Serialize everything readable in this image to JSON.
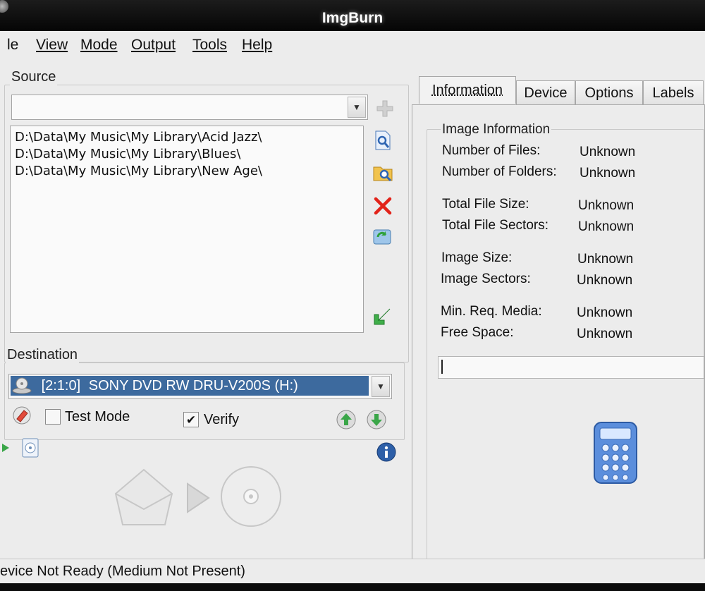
{
  "window": {
    "title": "ImgBurn"
  },
  "menu": [
    {
      "label": "le",
      "underline": ""
    },
    {
      "label": "View",
      "underline": "V"
    },
    {
      "label": "Mode",
      "underline": "M"
    },
    {
      "label": "Output",
      "underline": "O"
    },
    {
      "label": "Tools",
      "underline": "T"
    },
    {
      "label": "Help",
      "underline": "H"
    }
  ],
  "source": {
    "group_label": "Source",
    "combo_value": "",
    "items": [
      "D:\\Data\\My Music\\My Library\\Acid Jazz\\",
      "D:\\Data\\My Music\\My Library\\Blues\\",
      "D:\\Data\\My Music\\My Library\\New Age\\"
    ],
    "icons": [
      "add-icon",
      "browse-file-icon",
      "browse-folder-icon",
      "remove-icon",
      "clear-icon",
      "move-icon"
    ]
  },
  "destination": {
    "group_label": "Destination",
    "drive_id": "[2:1:0]",
    "drive_name": "SONY DVD RW DRU-V200S (H:)",
    "test_mode_label": "Test Mode",
    "test_mode_checked": false,
    "verify_label": "Verify",
    "verify_checked": true,
    "verify_mark": "✔"
  },
  "tabs": [
    {
      "label": "Information",
      "active": true
    },
    {
      "label": "Device",
      "active": false
    },
    {
      "label": "Options",
      "active": false
    },
    {
      "label": "Labels",
      "active": false
    }
  ],
  "info": {
    "group_label": "Image Information",
    "rows": [
      {
        "label": "Number of Files:",
        "value": "Unknown"
      },
      {
        "label": "Number of Folders:",
        "value": "Unknown"
      },
      {
        "label": "Total File Size:",
        "value": "Unknown"
      },
      {
        "label": "Total File Sectors:",
        "value": "Unknown"
      },
      {
        "label": "Image Size:",
        "value": "Unknown"
      },
      {
        "label": "Image Sectors:",
        "value": "Unknown"
      },
      {
        "label": "Min. Req. Media:",
        "value": "Unknown"
      },
      {
        "label": "Free Space:",
        "value": "Unknown"
      }
    ]
  },
  "status": {
    "text": "evice Not Ready (Medium Not Present)"
  },
  "colors": {
    "selection": "#3d6a9e",
    "titlebar": "#0b0b0b",
    "window_bg": "#ececec"
  }
}
